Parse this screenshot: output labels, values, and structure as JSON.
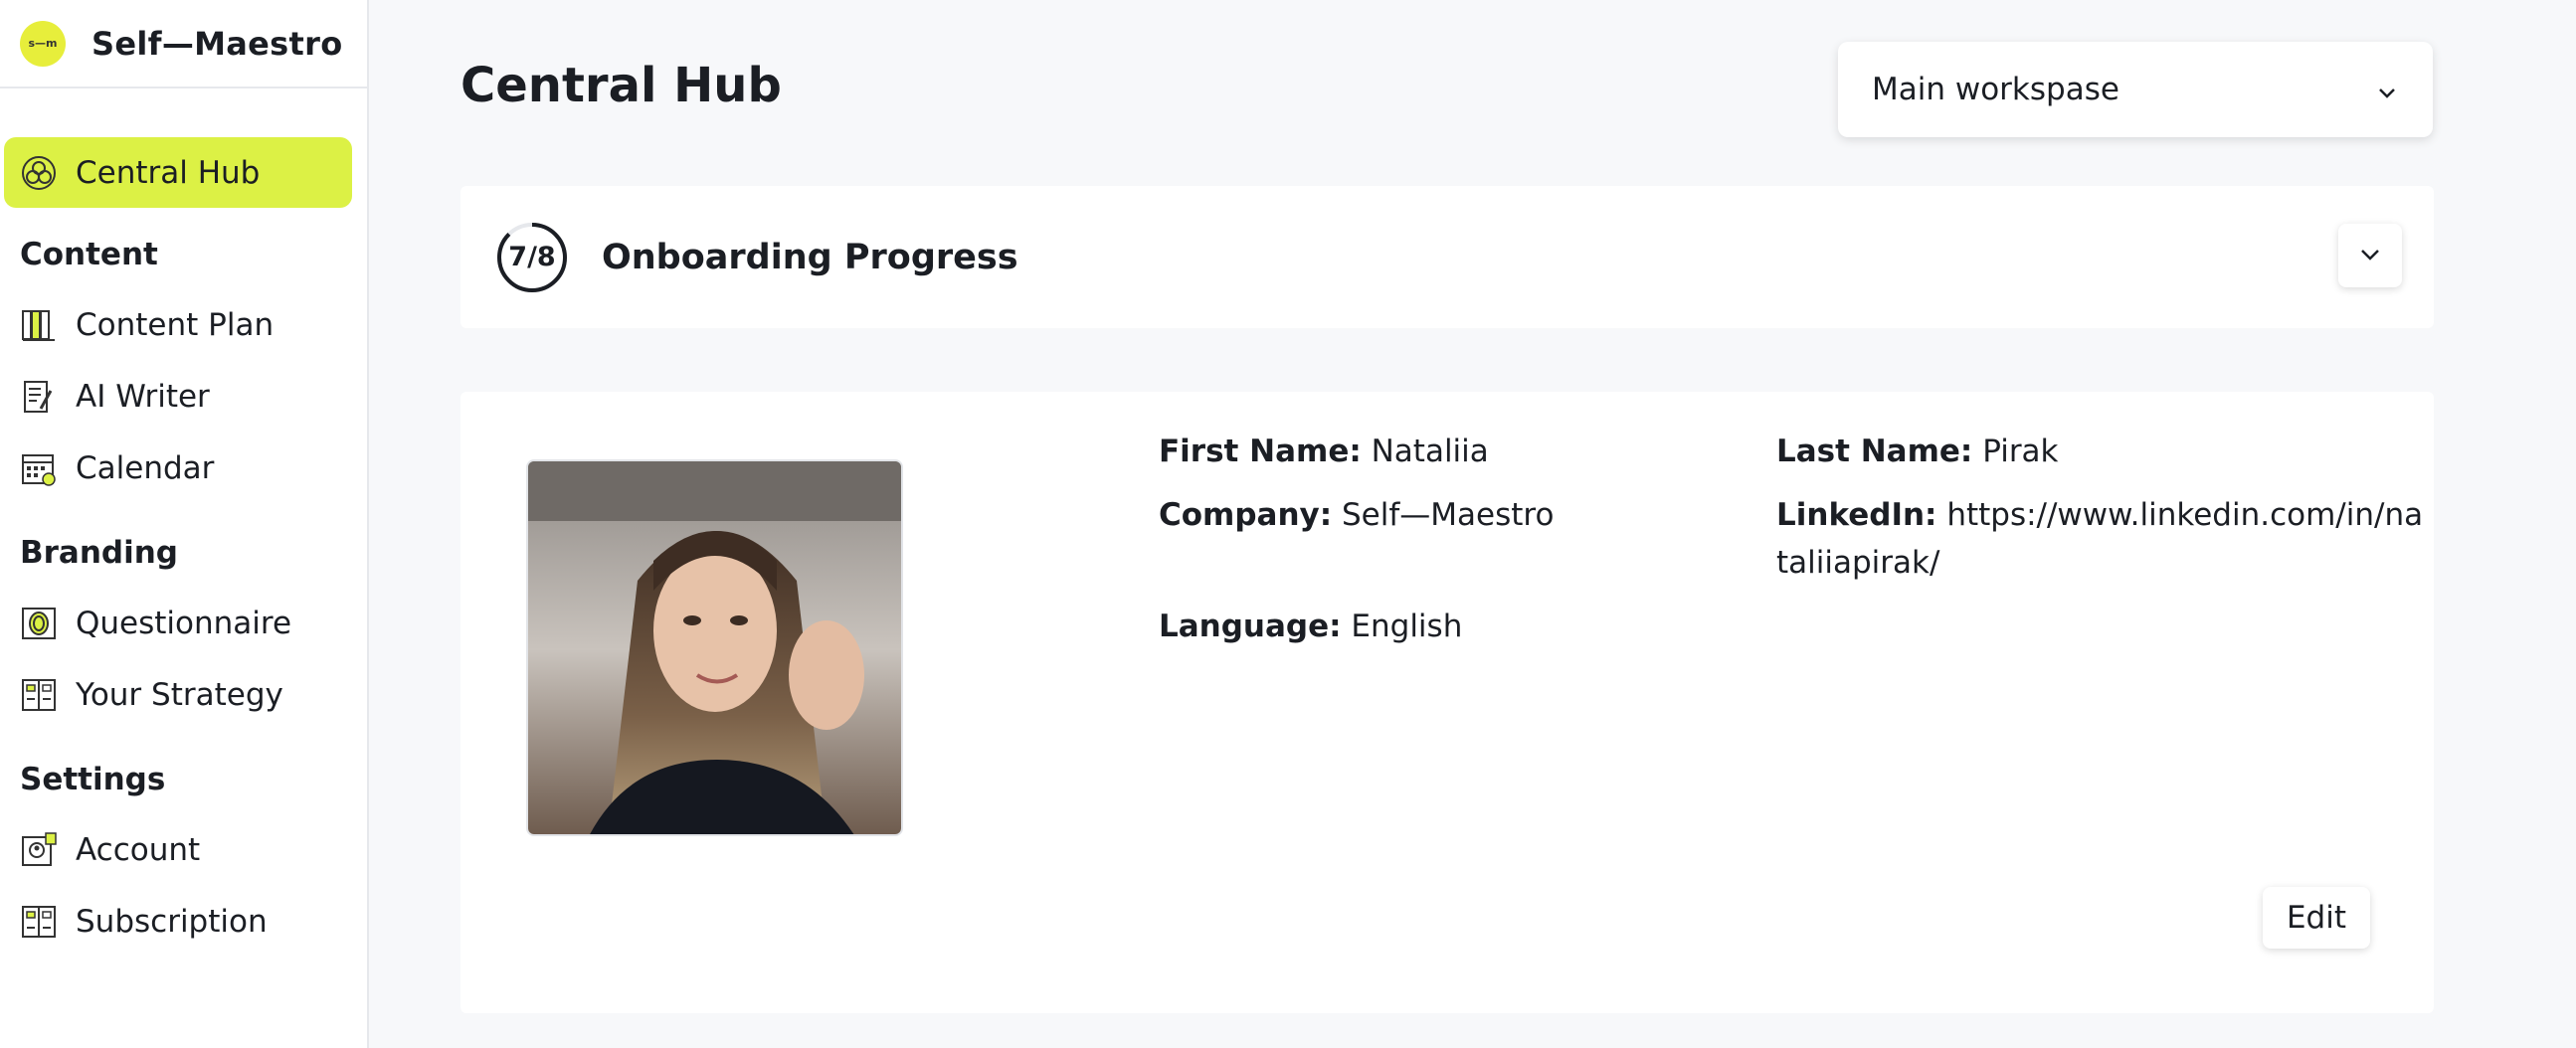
{
  "brand": {
    "name": "Self—Maestro",
    "logo_text": "s—m"
  },
  "sidebar": {
    "items": [
      {
        "label": "Central Hub",
        "icon": "hub-icon",
        "active": true
      },
      {
        "section": "Content"
      },
      {
        "label": "Content Plan",
        "icon": "books-icon"
      },
      {
        "label": "AI Writer",
        "icon": "document-pen-icon"
      },
      {
        "label": "Calendar",
        "icon": "calendar-icon"
      },
      {
        "section": "Branding"
      },
      {
        "label": "Questionnaire",
        "icon": "fingerprint-icon"
      },
      {
        "label": "Your Strategy",
        "icon": "strategy-board-icon"
      },
      {
        "section": "Settings"
      },
      {
        "label": "Account",
        "icon": "account-icon"
      },
      {
        "label": "Subscription",
        "icon": "subscription-icon"
      }
    ],
    "labels": {
      "central_hub": "Central Hub",
      "content": "Content",
      "content_plan": "Content Plan",
      "ai_writer": "AI Writer",
      "calendar": "Calendar",
      "branding": "Branding",
      "questionnaire": "Questionnaire",
      "your_strategy": "Your Strategy",
      "settings": "Settings",
      "account": "Account",
      "subscription": "Subscription"
    }
  },
  "header": {
    "title": "Central Hub",
    "workspace": {
      "selected": "Main workspase"
    }
  },
  "onboarding": {
    "title": "Onboarding Progress",
    "progress_label": "7/8",
    "completed": 7,
    "total": 8
  },
  "profile": {
    "first_name_label": "First Name:",
    "first_name": "Nataliia",
    "last_name_label": "Last Name:",
    "last_name": "Pirak",
    "company_label": "Company:",
    "company": "Self—Maestro",
    "linkedin_label": "LinkedIn:",
    "linkedin_line1": "https://www.linkedin.com/in/na",
    "linkedin_line2": "taliiapirak/",
    "language_label": "Language:",
    "language": "English",
    "edit_label": "Edit"
  },
  "colors": {
    "accent": "#dcf145",
    "logo": "#e7ee3b",
    "background": "#f7f8fa",
    "text": "#1b1e24"
  }
}
